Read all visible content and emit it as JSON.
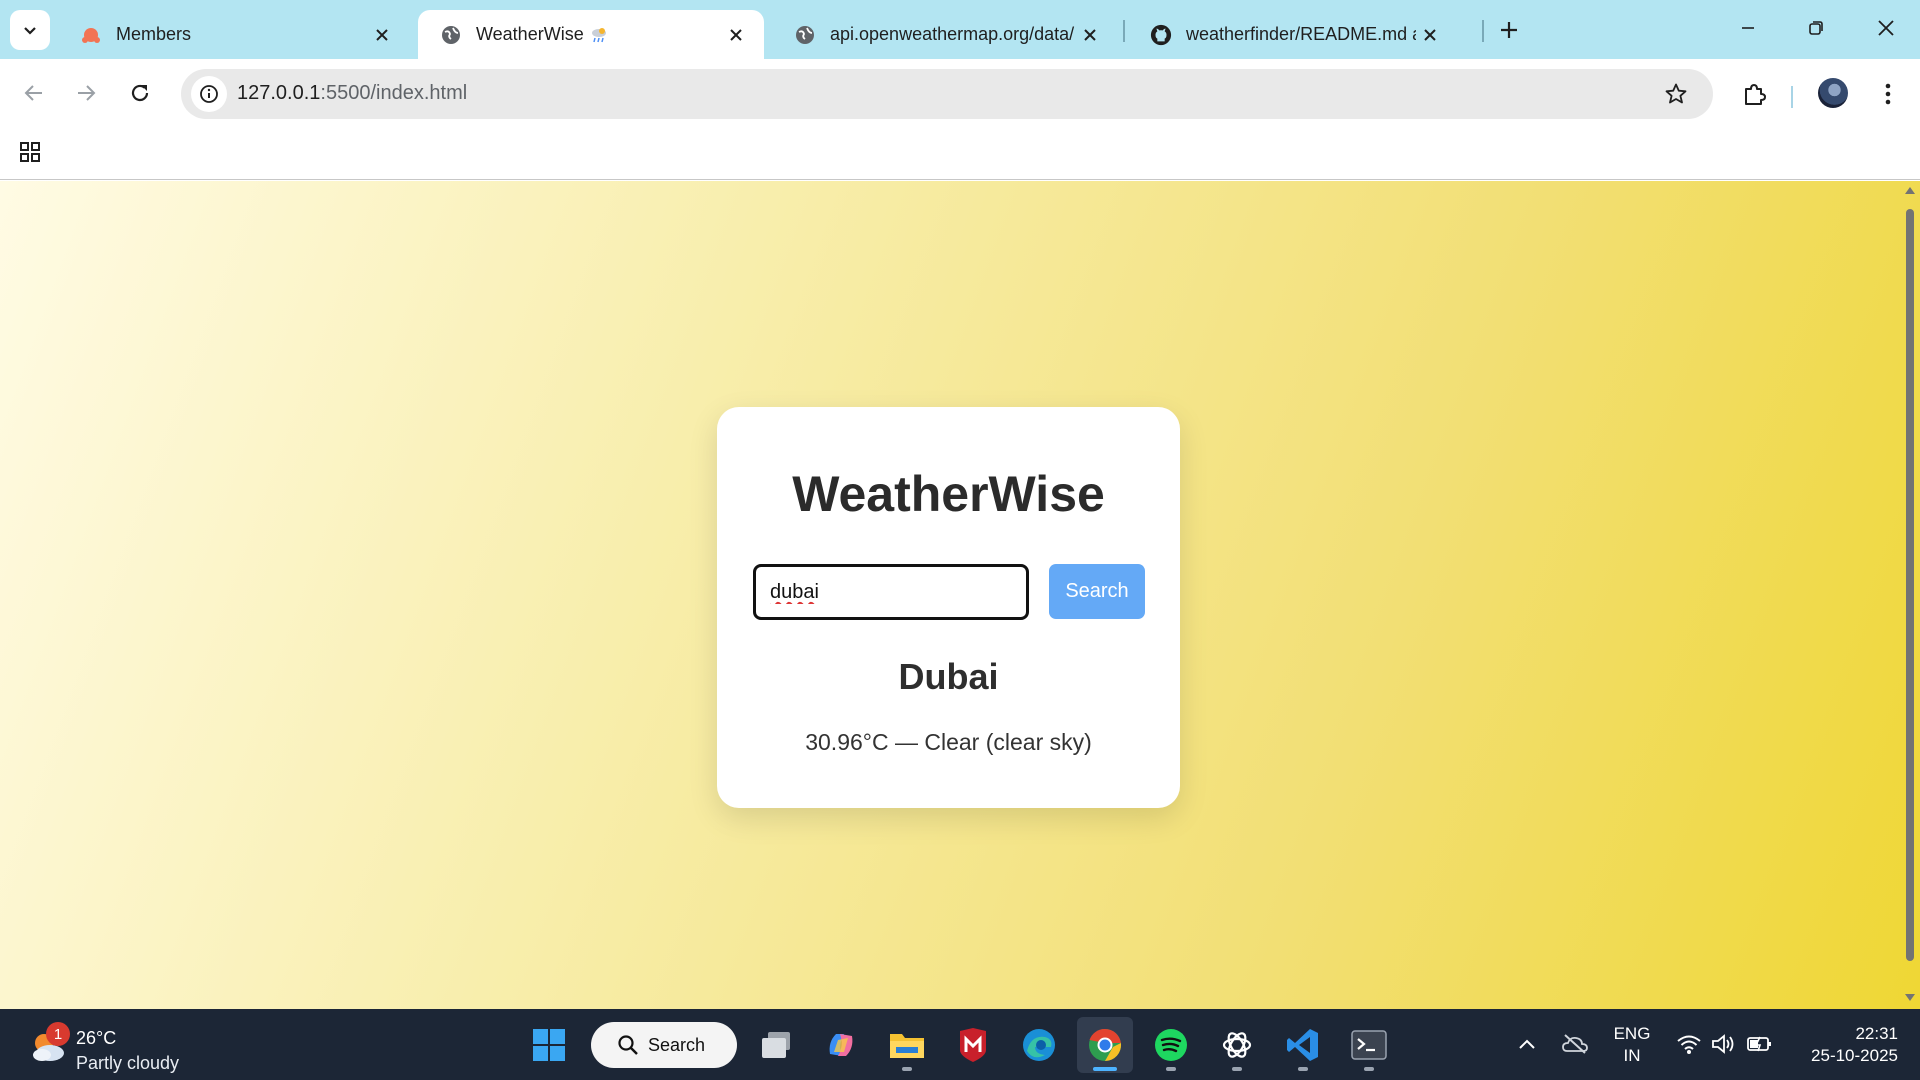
{
  "browser": {
    "tabs": [
      {
        "title": "Members",
        "active": false
      },
      {
        "title": "WeatherWise",
        "active": true
      },
      {
        "title": "api.openweathermap.org/data/",
        "active": false
      },
      {
        "title": "weatherfinder/README.md at m",
        "active": false
      }
    ],
    "url_host": "127.0.0.1",
    "url_path": ":5500/index.html"
  },
  "page": {
    "app_title": "WeatherWise",
    "search": {
      "value": "dubai",
      "button_label": "Search"
    },
    "result": {
      "city": "Dubai",
      "description": "30.96°C — Clear (clear sky)"
    }
  },
  "taskbar": {
    "weather": {
      "temp": "26°C",
      "condition": "Partly cloudy",
      "badge": "1"
    },
    "search_label": "Search",
    "language": {
      "line1": "ENG",
      "line2": "IN"
    },
    "time": "22:31",
    "date": "25-10-2025"
  },
  "colors": {
    "tabstrip": "#b3e5f2",
    "accent_button": "#64a9f6",
    "taskbar": "#1c2636",
    "page_gradient_start": "#fffbe4",
    "page_gradient_end": "#efd734"
  }
}
